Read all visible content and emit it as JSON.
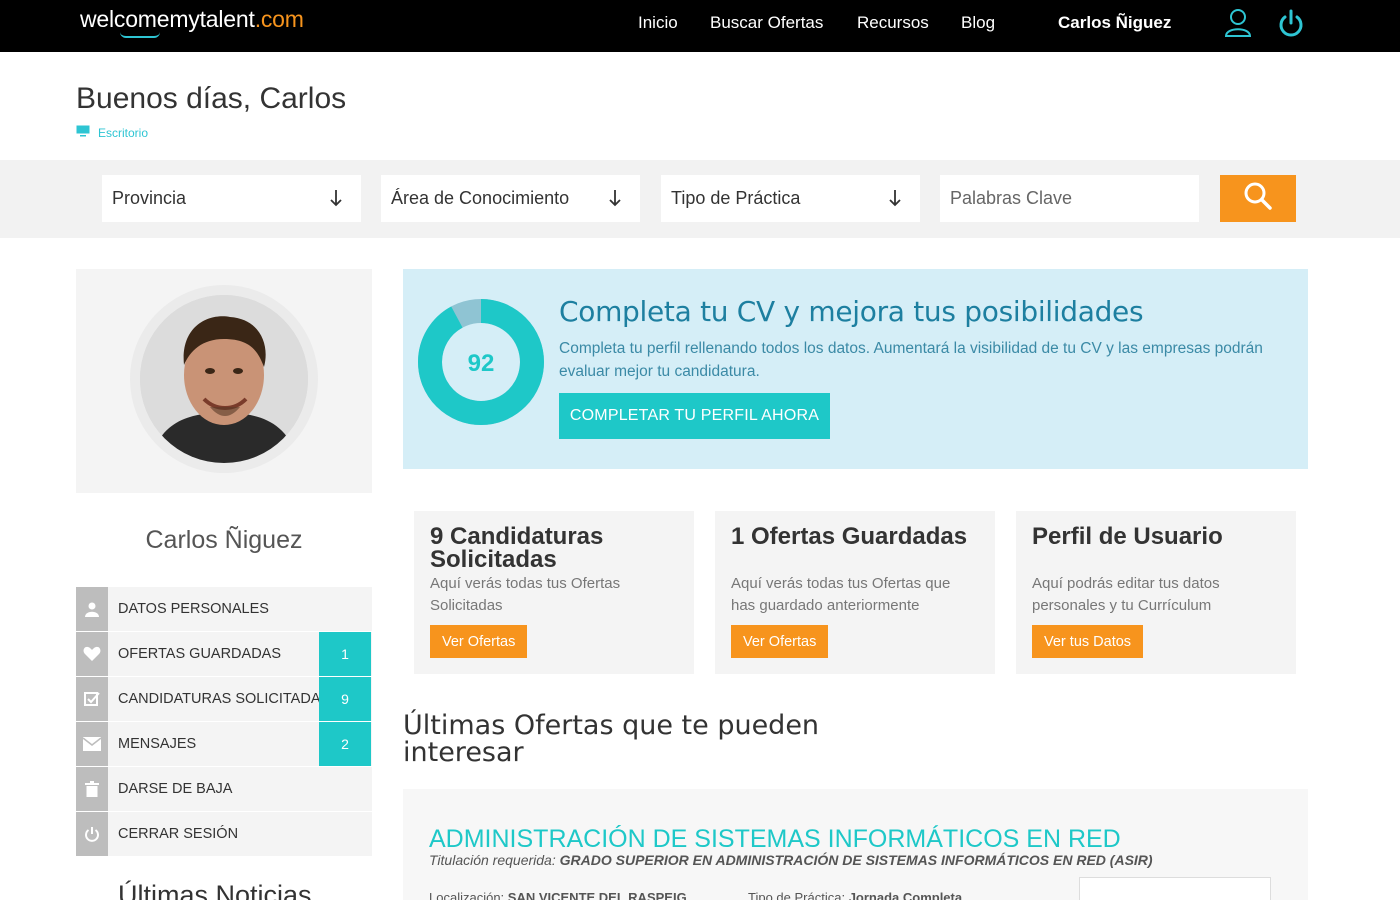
{
  "header": {
    "logo_main": "welcomemytalent",
    "logo_suffix": ".com",
    "nav": [
      "Inicio",
      "Buscar Ofertas",
      "Recursos",
      "Blog"
    ],
    "user_name": "Carlos Ñiguez"
  },
  "page": {
    "greeting": "Buenos días, Carlos",
    "breadcrumb": "Escritorio"
  },
  "search": {
    "provincia": "Provincia",
    "area": "Área de Conocimiento",
    "tipo": "Tipo de Práctica",
    "keywords_placeholder": "Palabras Clave"
  },
  "profile": {
    "name": "Carlos Ñiguez"
  },
  "menu": [
    {
      "label": "Datos Personales",
      "icon": "user-icon",
      "count": null
    },
    {
      "label": "Ofertas Guardadas",
      "icon": "heart-icon",
      "count": "1"
    },
    {
      "label": "Candidaturas Solicitadas",
      "icon": "checkbox-icon",
      "count": "9"
    },
    {
      "label": "Mensajes",
      "icon": "envelope-icon",
      "count": "2"
    },
    {
      "label": "Darse de Baja",
      "icon": "trash-icon",
      "count": null
    },
    {
      "label": "Cerrar Sesión",
      "icon": "power-icon",
      "count": null
    }
  ],
  "news_title": "Últimas Noticias",
  "cv": {
    "progress": 92,
    "title": "Completa tu CV y mejora tus posibilidades",
    "description": "Completa tu perfil rellenando todos los datos. Aumentará la visibilidad de tu CV y las empresas podrán evaluar mejor tu candidatura.",
    "button": "COMPLETAR TU PERFIL AHORA"
  },
  "cards": [
    {
      "title": "9 Candidaturas Solicitadas",
      "desc": "Aquí verás todas tus Ofertas Solicitadas",
      "button": "Ver Ofertas"
    },
    {
      "title": "1 Ofertas Guardadas",
      "desc": "Aquí verás todas tus Ofertas que has guardado anteriormente",
      "button": "Ver Ofertas"
    },
    {
      "title": "Perfil de Usuario",
      "desc": "Aquí podrás editar tus datos personales y tu Currículum",
      "button": "Ver tus Datos"
    }
  ],
  "latest_title": "Últimas Ofertas que te pueden interesar",
  "offer": {
    "title": "ADMINISTRACIÓN DE SISTEMAS INFORMÁTICOS EN RED",
    "req_label": "Titulación requerida:",
    "req_value": "GRADO SUPERIOR EN ADMINISTRACIÓN DE SISTEMAS INFORMÁTICOS EN RED (ASIR)",
    "location_label": "Localización:",
    "location": "SAN VICENTE DEL RASPEIG",
    "type_label": "Tipo de Práctica:",
    "type": "Jornada Completa"
  },
  "colors": {
    "accent_orange": "#f7941d",
    "accent_teal": "#1ec8c8",
    "cv_bg": "#d5eef7"
  }
}
